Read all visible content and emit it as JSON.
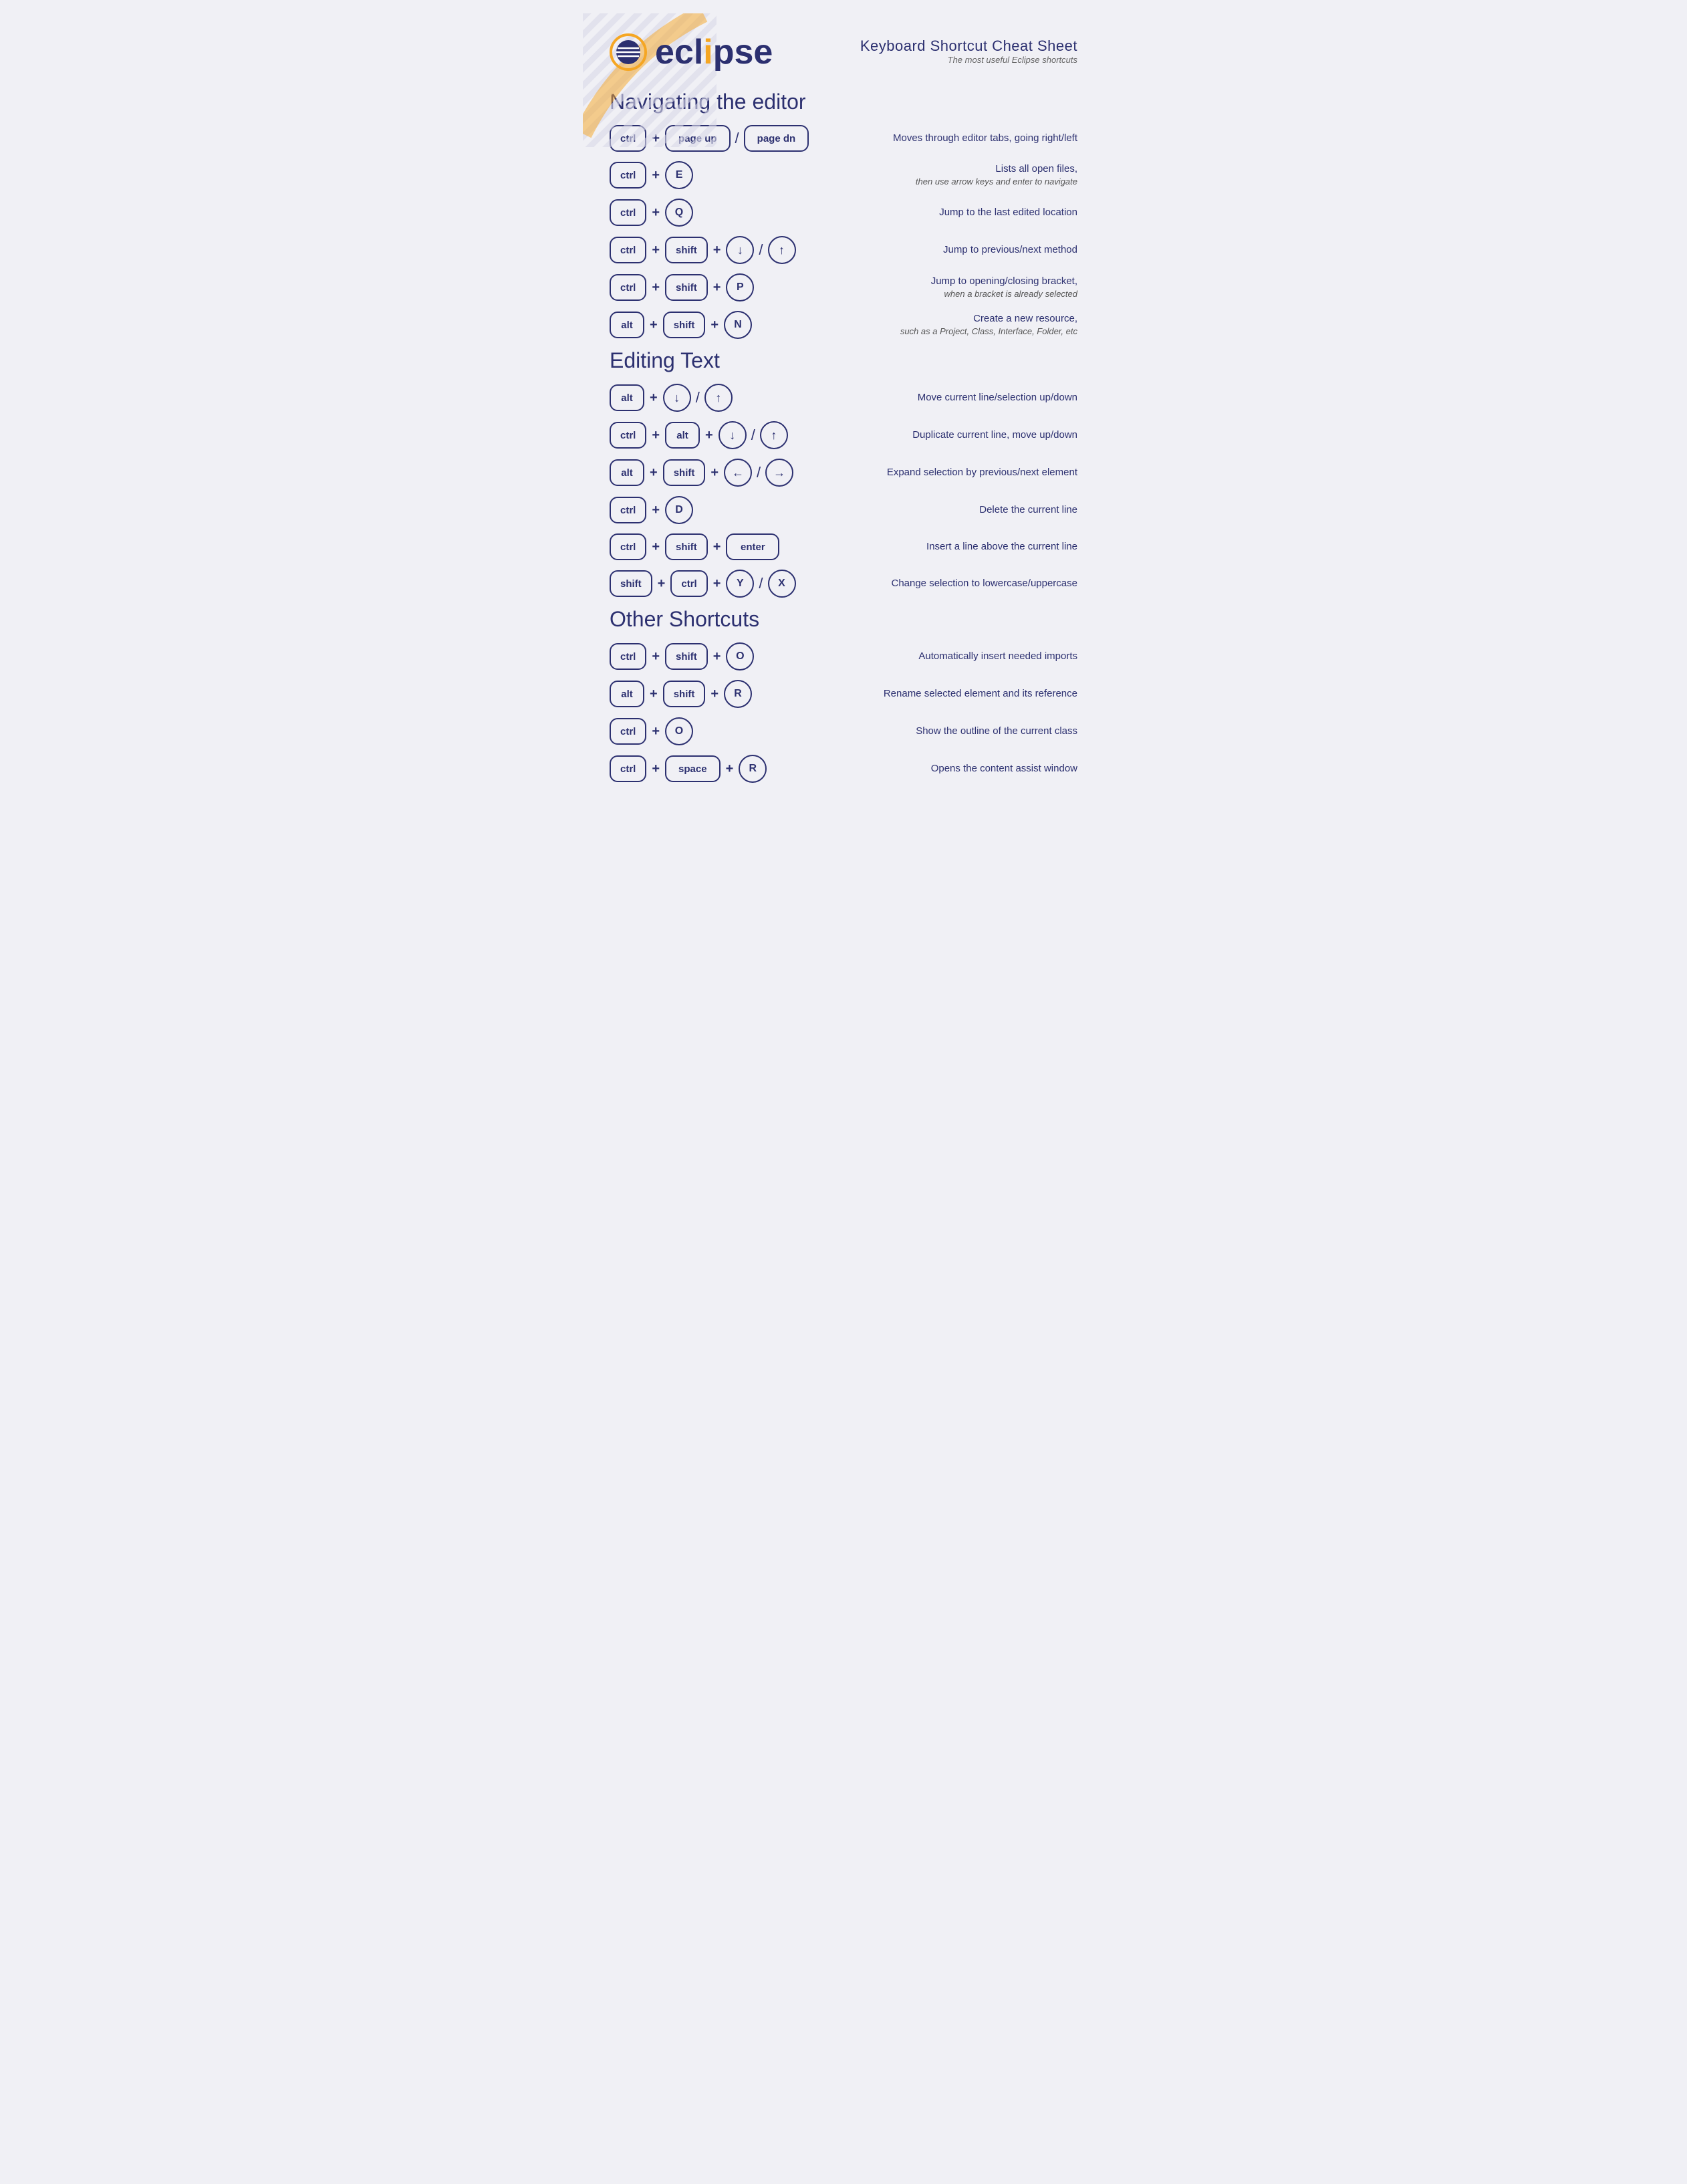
{
  "logo": {
    "text_before_dot": "ecl",
    "dot": "i",
    "text_after_dot": "pse"
  },
  "header": {
    "title": "Keyboard Shortcut Cheat Sheet",
    "subtitle": "The most useful Eclipse shortcuts"
  },
  "sections": [
    {
      "id": "navigating",
      "title": "Navigating the editor",
      "shortcuts": [
        {
          "keys": [
            [
              "ctrl"
            ],
            "+",
            [
              "page up"
            ],
            "/",
            [
              "page dn"
            ]
          ],
          "desc": "Moves through editor tabs, going right/left",
          "desc_sub": ""
        },
        {
          "keys": [
            [
              "ctrl"
            ],
            "+",
            [
              "E"
            ]
          ],
          "desc": "Lists all open files,",
          "desc_sub": "then use arrow keys and enter to navigate"
        },
        {
          "keys": [
            [
              "ctrl"
            ],
            "+",
            [
              "Q"
            ]
          ],
          "desc": "Jump to the last edited location",
          "desc_sub": ""
        },
        {
          "keys": [
            [
              "ctrl"
            ],
            "+",
            [
              "shift"
            ],
            "+",
            [
              "↓"
            ],
            "/",
            [
              "↑"
            ]
          ],
          "desc": "Jump to previous/next method",
          "desc_sub": ""
        },
        {
          "keys": [
            [
              "ctrl"
            ],
            "+",
            [
              "shift"
            ],
            "+",
            [
              "P"
            ]
          ],
          "desc": "Jump to opening/closing bracket,",
          "desc_sub": "when a bracket is already selected"
        },
        {
          "keys": [
            [
              "alt"
            ],
            "+",
            [
              "shift"
            ],
            "+",
            [
              "N"
            ]
          ],
          "desc": "Create a new resource,",
          "desc_sub": "such as a Project, Class, Interface, Folder, etc"
        }
      ]
    },
    {
      "id": "editing",
      "title": "Editing Text",
      "shortcuts": [
        {
          "keys": [
            [
              "alt"
            ],
            "+",
            [
              "↓"
            ],
            "/",
            [
              "↑"
            ]
          ],
          "desc": "Move current line/selection up/down",
          "desc_sub": ""
        },
        {
          "keys": [
            [
              "ctrl"
            ],
            "+",
            [
              "alt"
            ],
            "+",
            [
              "↓"
            ],
            "/",
            [
              "↑"
            ]
          ],
          "desc": "Duplicate current line, move up/down",
          "desc_sub": ""
        },
        {
          "keys": [
            [
              "alt"
            ],
            "+",
            [
              "shift"
            ],
            "+",
            [
              "←"
            ],
            "/",
            [
              "→"
            ]
          ],
          "desc": "Expand selection by previous/next element",
          "desc_sub": ""
        },
        {
          "keys": [
            [
              "ctrl"
            ],
            "+",
            [
              "D"
            ]
          ],
          "desc": "Delete the current line",
          "desc_sub": ""
        },
        {
          "keys": [
            [
              "ctrl"
            ],
            "+",
            [
              "shift"
            ],
            "+",
            [
              "enter"
            ]
          ],
          "desc": "Insert a line above the current line",
          "desc_sub": ""
        },
        {
          "keys": [
            [
              "shift"
            ],
            "+",
            [
              "ctrl"
            ],
            "+",
            [
              "Y"
            ],
            "/",
            [
              "X"
            ]
          ],
          "desc": "Change selection to lowercase/uppercase",
          "desc_sub": ""
        }
      ]
    },
    {
      "id": "other",
      "title": "Other Shortcuts",
      "shortcuts": [
        {
          "keys": [
            [
              "ctrl"
            ],
            "+",
            [
              "shift"
            ],
            "+",
            [
              "O"
            ]
          ],
          "desc": "Automatically insert needed imports",
          "desc_sub": ""
        },
        {
          "keys": [
            [
              "alt"
            ],
            "+",
            [
              "shift"
            ],
            "+",
            [
              "R"
            ]
          ],
          "desc": "Rename selected element and its reference",
          "desc_sub": ""
        },
        {
          "keys": [
            [
              "ctrl"
            ],
            "+",
            [
              "O"
            ]
          ],
          "desc": "Show the outline of the current class",
          "desc_sub": ""
        },
        {
          "keys": [
            [
              "ctrl"
            ],
            "+",
            [
              "space"
            ],
            "+",
            [
              "R"
            ]
          ],
          "desc": "Opens the content assist window",
          "desc_sub": ""
        }
      ]
    }
  ]
}
